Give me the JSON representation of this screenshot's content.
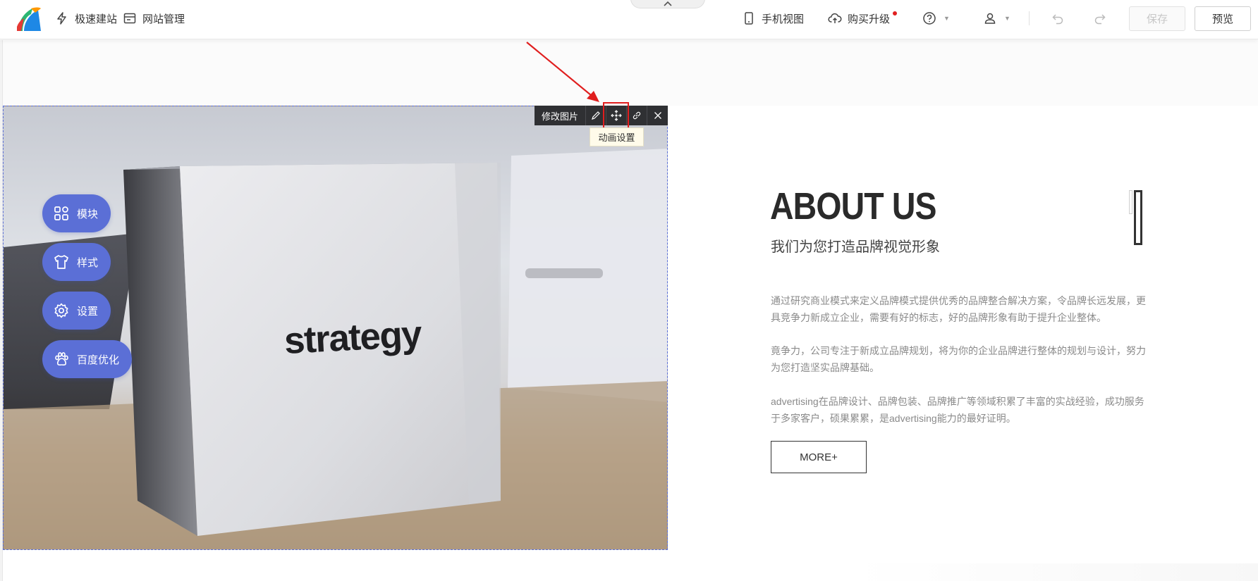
{
  "toolbar": {
    "quick_build": "极速建站",
    "site_manage": "网站管理",
    "mobile_view": "手机视图",
    "upgrade": "购买升级",
    "save": "保存",
    "preview": "预览"
  },
  "image_toolbar": {
    "edit_image": "修改图片",
    "tooltip": "动画设置"
  },
  "photo": {
    "box_text": "strategy"
  },
  "side_menu": [
    {
      "label": "模块",
      "icon": "grid-icon"
    },
    {
      "label": "样式",
      "icon": "shirt-icon"
    },
    {
      "label": "设置",
      "icon": "gear-icon"
    },
    {
      "label": "百度优化",
      "icon": "paw-icon"
    }
  ],
  "about": {
    "title": "ABOUT US",
    "subtitle": "我们为您打造品牌视觉形象",
    "paragraphs": [
      "通过研究商业模式来定义品牌模式提供优秀的品牌整合解决方案，令品牌长远发展，更具竞争力新成立企业，需要有好的标志，好的品牌形象有助于提升企业整体。",
      "竟争力，公司专注于新成立品牌规划，将为你的企业品牌进行整体的规划与设计，努力为您打造坚实品牌基础。",
      "advertising在品牌设计、品牌包装、品牌推广等领域积累了丰富的实战经验，成功服务于多家客户，硕果累累，是advertising能力的最好证明。"
    ],
    "more": "MORE+"
  },
  "colors": {
    "accent": "#5b6fd6",
    "highlight": "#e01e1e",
    "toolbar_dark": "#2f3033"
  }
}
